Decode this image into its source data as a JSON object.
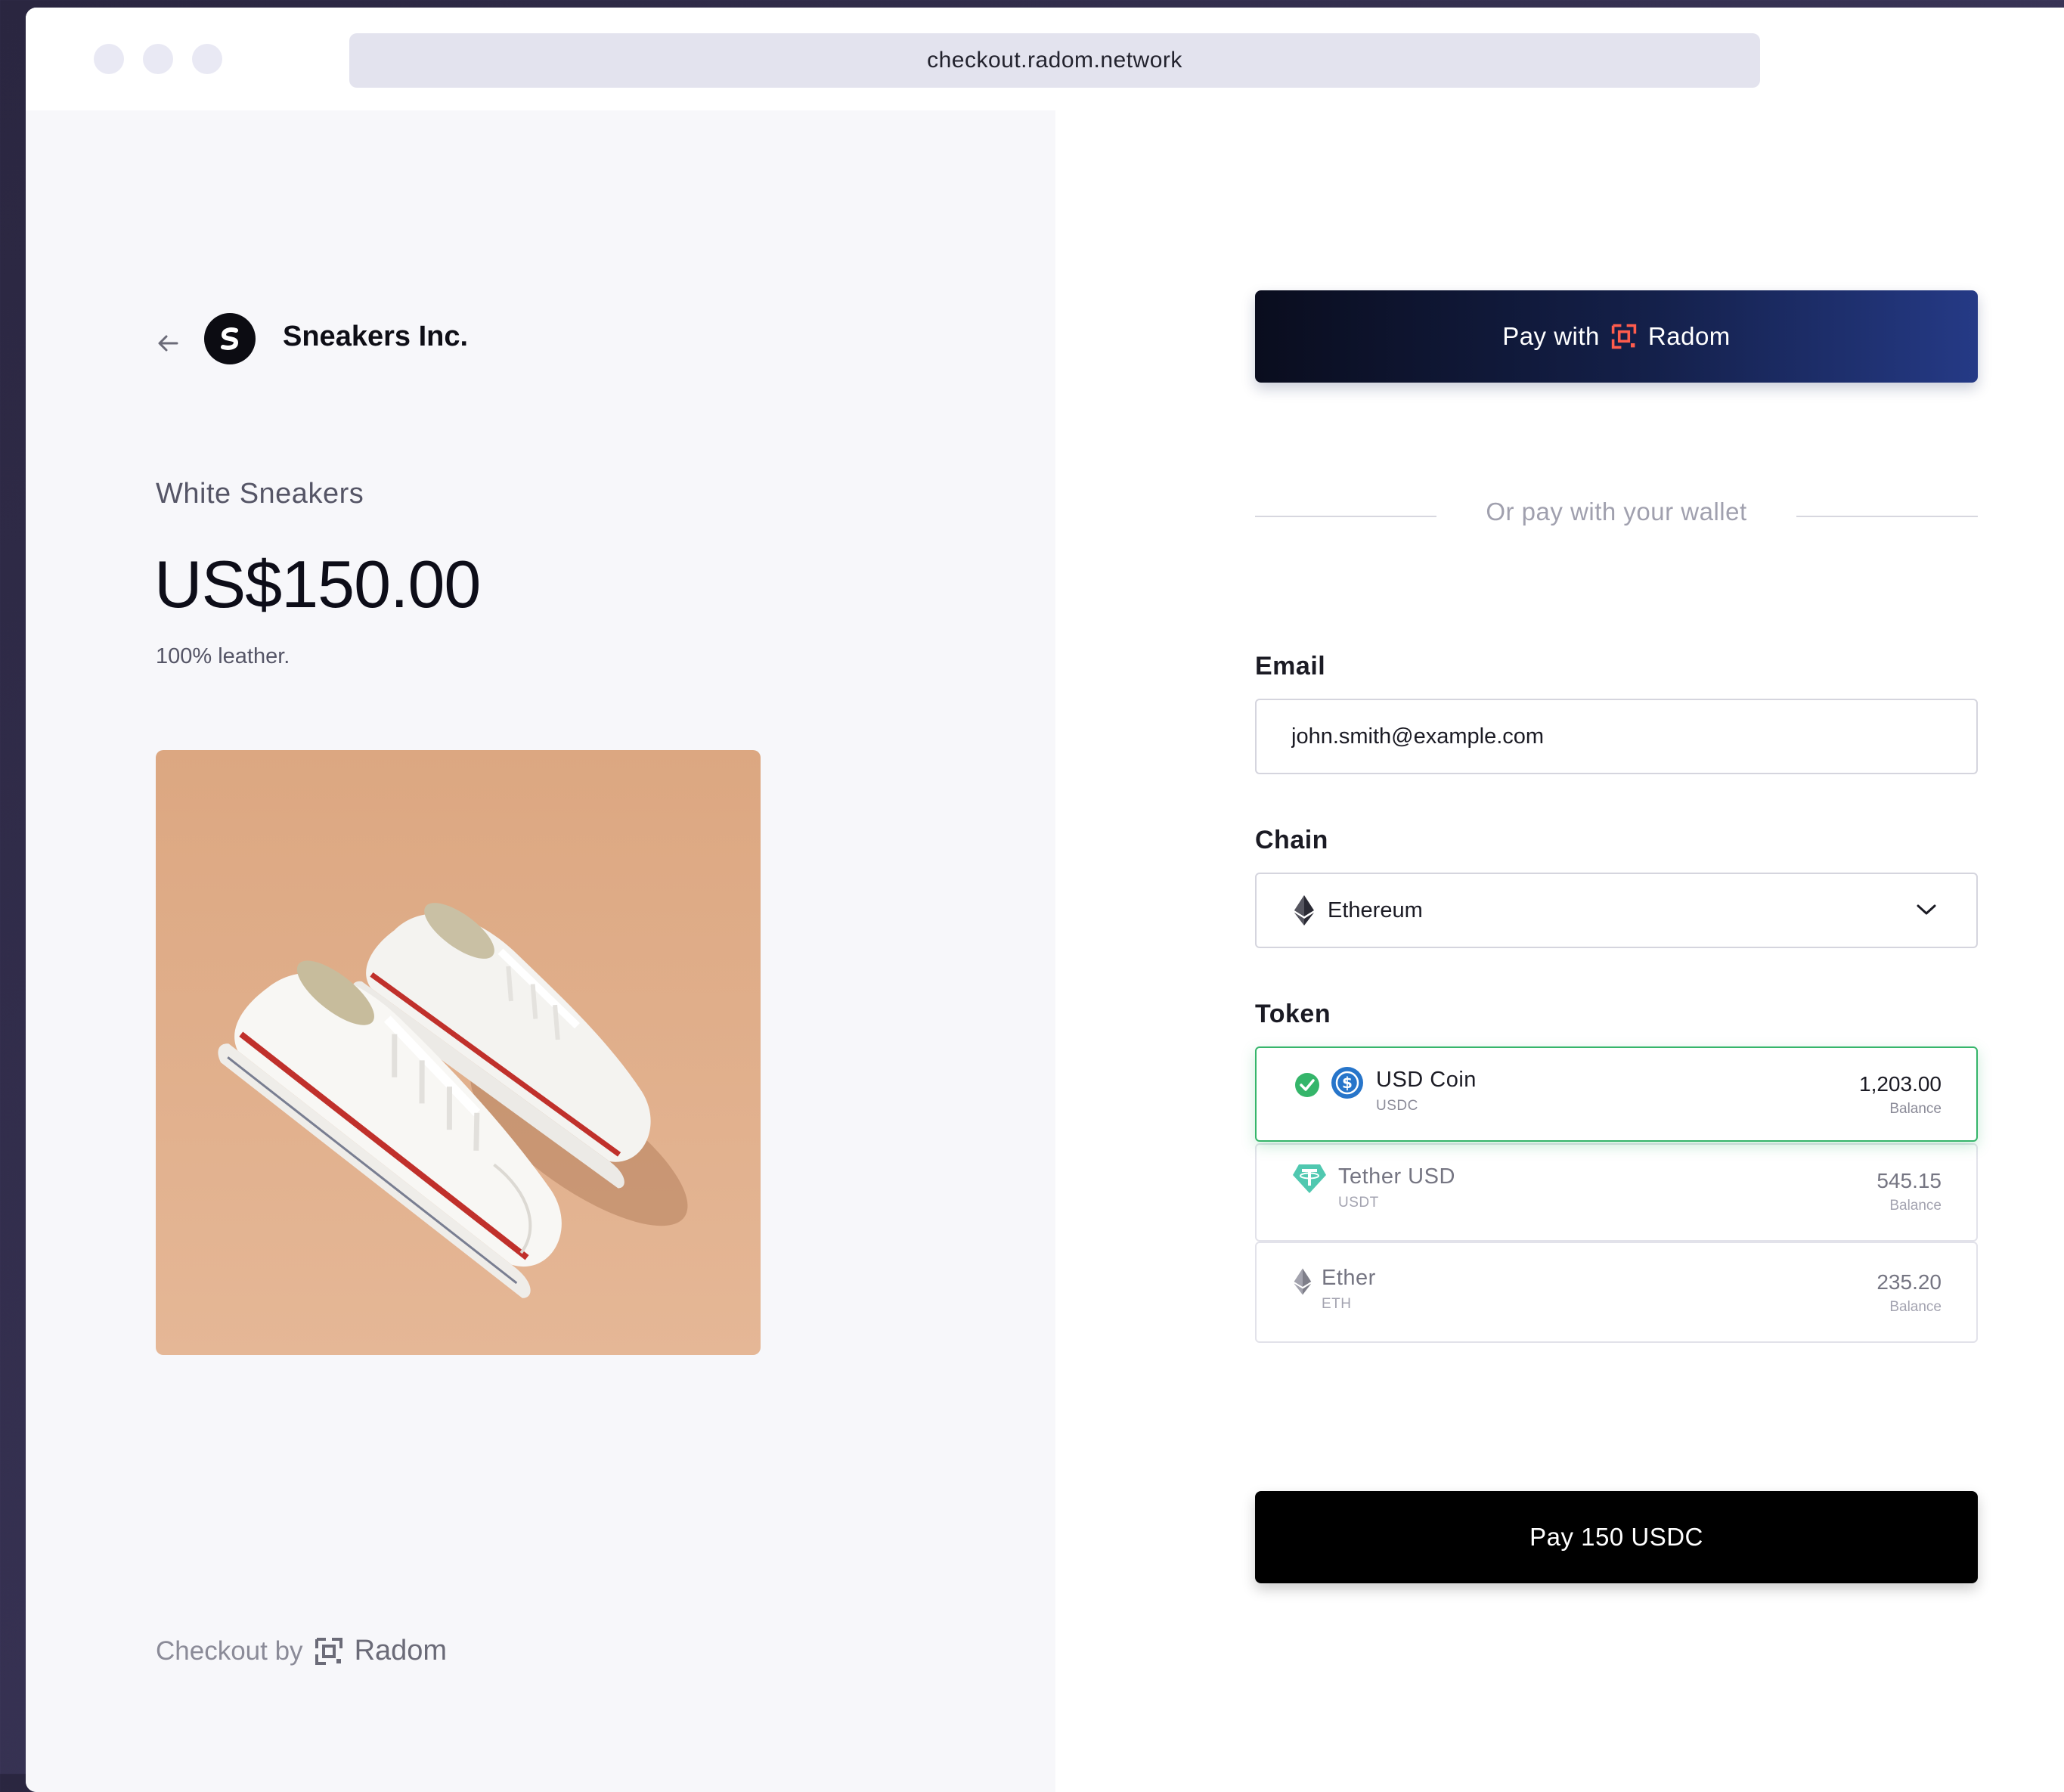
{
  "browser": {
    "url": "checkout.radom.network"
  },
  "merchant": {
    "name": "Sneakers Inc."
  },
  "product": {
    "name": "White Sneakers",
    "price": "US$150.00",
    "description": "100% leather."
  },
  "footer": {
    "checkout_by": "Checkout by",
    "brand": "Radom"
  },
  "radom_button": {
    "prefix": "Pay with",
    "brand": "Radom"
  },
  "divider_text": "Or pay with your wallet",
  "email": {
    "label": "Email",
    "value": "john.smith@example.com"
  },
  "chain": {
    "label": "Chain",
    "selected": "Ethereum"
  },
  "token": {
    "label": "Token",
    "options": [
      {
        "name": "USD Coin",
        "symbol": "USDC",
        "balance": "1,203.00",
        "balance_label": "Balance",
        "selected": true
      },
      {
        "name": "Tether USD",
        "symbol": "USDT",
        "balance": "545.15",
        "balance_label": "Balance",
        "selected": false
      },
      {
        "name": "Ether",
        "symbol": "ETH",
        "balance": "235.20",
        "balance_label": "Balance",
        "selected": false
      }
    ]
  },
  "pay_button": {
    "label": "Pay 150 USDC"
  },
  "colors": {
    "accent_green": "#35b56a",
    "radom_orange": "#ff5c4d",
    "usdc_blue": "#2775ca",
    "usdt_teal": "#50c8b0"
  }
}
